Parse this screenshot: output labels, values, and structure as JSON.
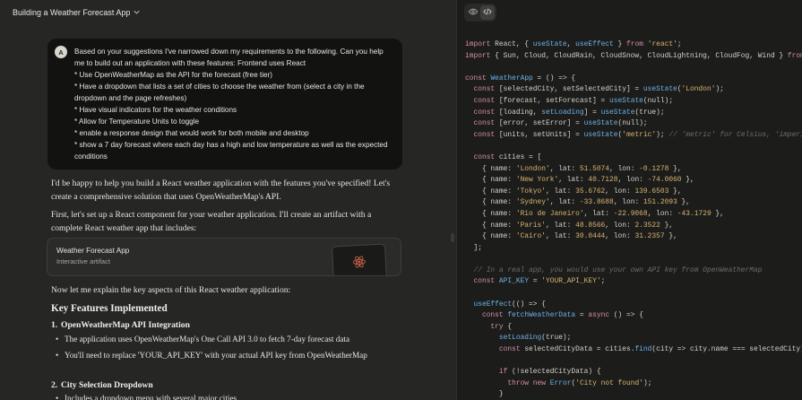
{
  "header": {
    "title": "Building a Weather Forecast App"
  },
  "user_message": {
    "avatar": "A",
    "lines": [
      "Based on your suggestions I've narrowed down my requirements to the following. Can you help me to build out an application with these features:  Frontend uses React",
      "* Use OpenWeatherMap as the API for the forecast (free tier)",
      "* Have a dropdown that lists a set of cities to choose the weather from (select a city in the dropdown and the page refreshes)",
      "* Have visual indicators for the weather conditions",
      "* Allow for Temperature Units to toggle",
      "* enable a response design that would work for both mobile and desktop",
      "* show a 7 day forecast where each day has a high and low temperature as well as the expected conditions"
    ]
  },
  "reply": {
    "p1": "I'd be happy to help you build a React weather application with the features you've specified! Let's create a comprehensive solution that uses OpenWeatherMap's API.",
    "p2": "First, let's set up a React component for your weather application. I'll create an artifact with a complete React weather app that includes:",
    "artifact_title": "Weather Forecast App",
    "artifact_sub": "Interactive artifact",
    "p3": "Now let me explain the key aspects of this React weather application:",
    "h2": "Key Features Implemented",
    "s1_num": "1.",
    "s1_title": "OpenWeatherMap API Integration",
    "s1_b1": "The application uses OpenWeatherMap's One Call API 3.0 to fetch 7-day forecast data",
    "s1_b2": "You'll need to replace 'YOUR_API_KEY' with your actual API key from OpenWeatherMap",
    "s2_num": "2.",
    "s2_title": "City Selection Dropdown",
    "s2_b1": "Includes a dropdown menu with several major cities"
  },
  "code_panel": {
    "icons": [
      "eye-icon",
      "code-icon"
    ],
    "lines": [
      "import React, { useState, useEffect } from 'react';",
      "import { Sun, Cloud, CloudRain, CloudSnow, CloudLightning, CloudFog, Wind } from 'luc",
      "",
      "const WeatherApp = () => {",
      "  const [selectedCity, setSelectedCity] = useState('London');",
      "  const [forecast, setForecast] = useState(null);",
      "  const [loading, setLoading] = useState(true);",
      "  const [error, setError] = useState(null);",
      "  const [units, setUnits] = useState('metric'); // 'metric' for Celsius, 'imperial' fo",
      "",
      "  const cities = [",
      "    { name: 'London', lat: 51.5074, lon: -0.1278 },",
      "    { name: 'New York', lat: 40.7128, lon: -74.0060 },",
      "    { name: 'Tokyo', lat: 35.6762, lon: 139.6503 },",
      "    { name: 'Sydney', lat: -33.8688, lon: 151.2093 },",
      "    { name: 'Rio de Janeiro', lat: -22.9068, lon: -43.1729 },",
      "    { name: 'Paris', lat: 48.8566, lon: 2.3522 },",
      "    { name: 'Cairo', lat: 30.0444, lon: 31.2357 },",
      "  ];",
      "",
      "  // In a real app, you would use your own API key from OpenWeatherMap",
      "  const API_KEY = 'YOUR_API_KEY';",
      "",
      "  useEffect(() => {",
      "    const fetchWeatherData = async () => {",
      "      try {",
      "        setLoading(true);",
      "        const selectedCityData = cities.find(city => city.name === selectedCity);",
      "",
      "        if (!selectedCityData) {",
      "          throw new Error('City not found');",
      "        }"
    ]
  }
}
